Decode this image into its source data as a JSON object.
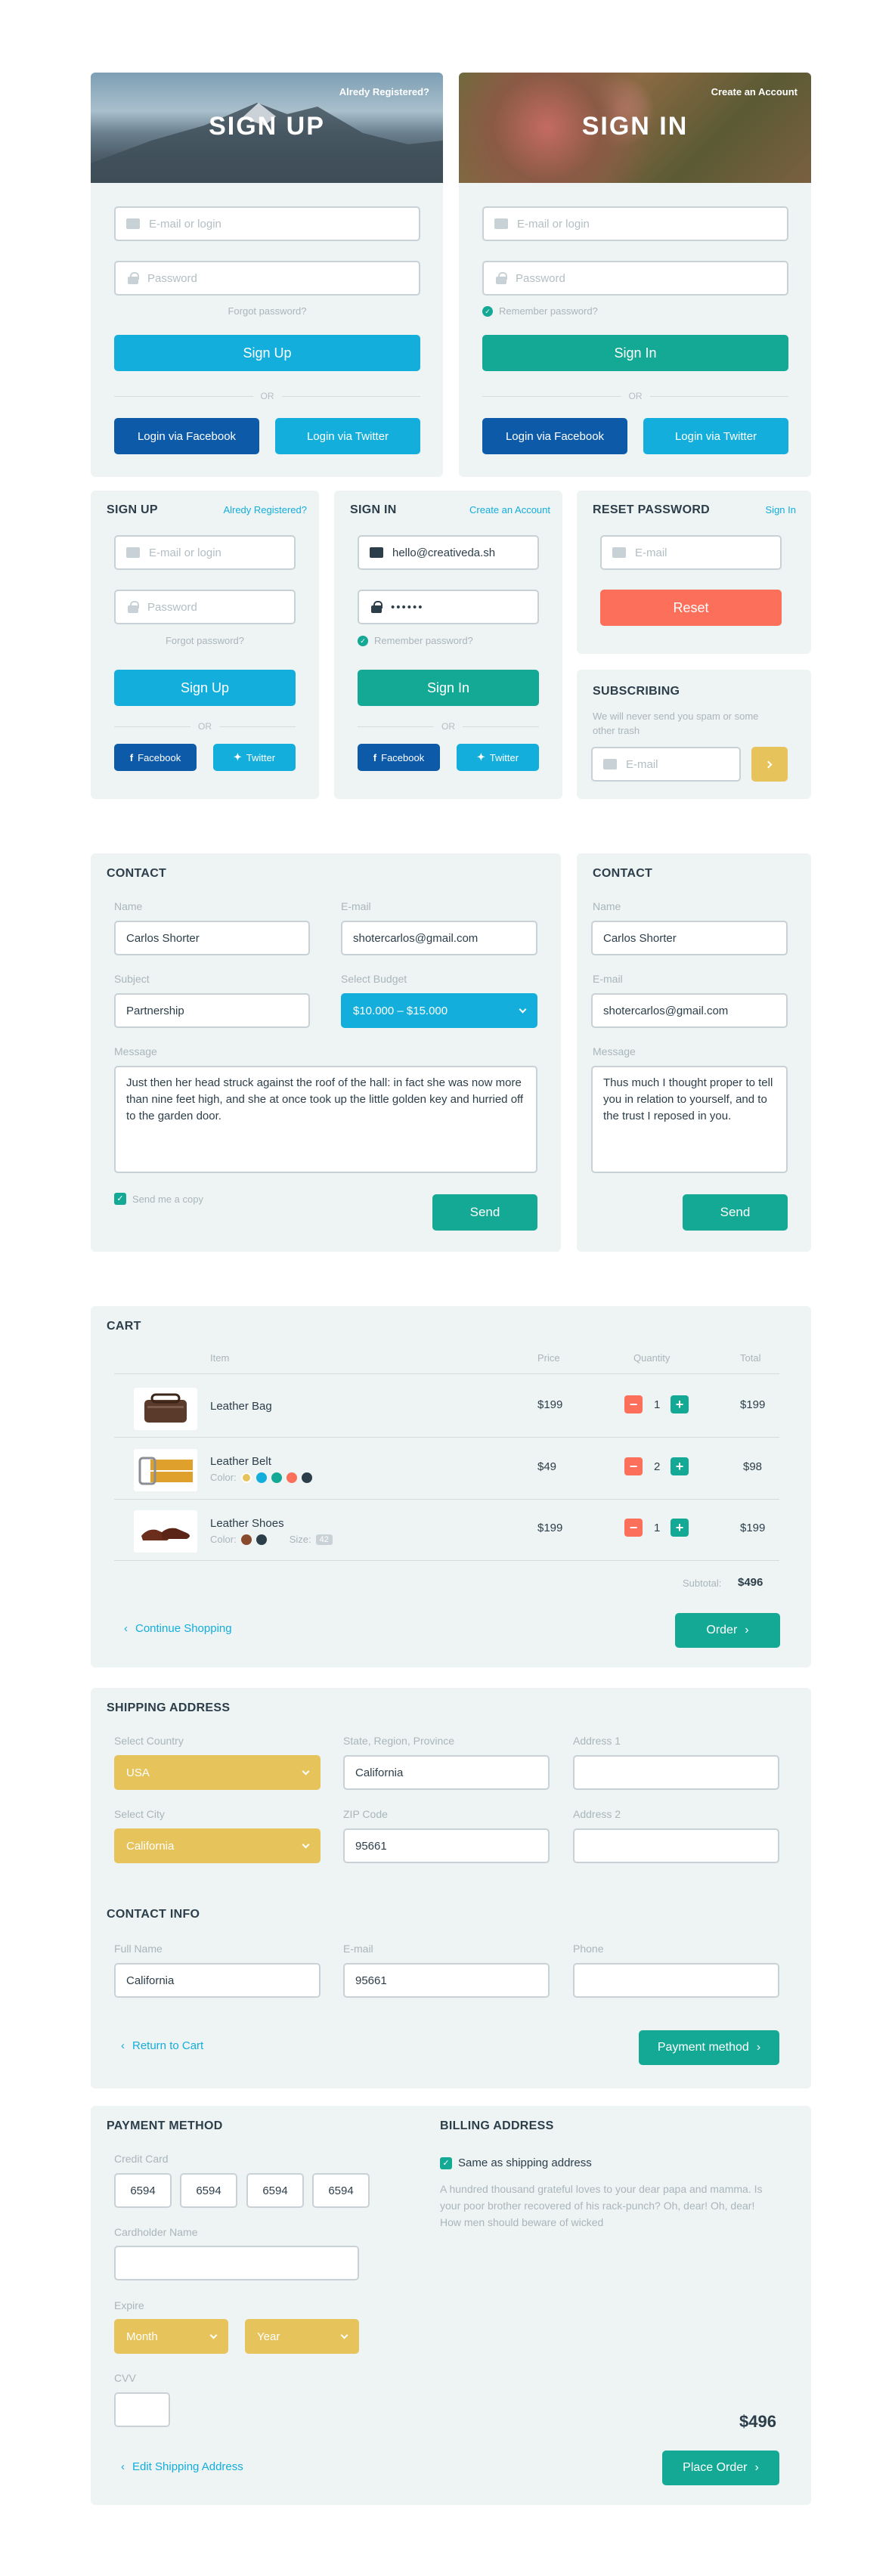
{
  "colors": {
    "blue": "#13aedb",
    "teal": "#14a994",
    "navy": "#0c5aa8",
    "coral": "#fb6f5b",
    "yellow": "#e6c45b",
    "panel": "#eef3f4"
  },
  "signup_large": {
    "title": "SIGN UP",
    "corner_link": "Alredy Registered?",
    "email_placeholder": "E-mail or login",
    "password_placeholder": "Password",
    "forgot": "Forgot password?",
    "button": "Sign Up",
    "or": "OR",
    "facebook": "Login via Facebook",
    "twitter": "Login via Twitter"
  },
  "signin_large": {
    "title": "SIGN IN",
    "corner_link": "Create an Account",
    "email_placeholder": "E-mail or login",
    "password_placeholder": "Password",
    "remember": "Remember password?",
    "button": "Sign In",
    "or": "OR",
    "facebook": "Login via Facebook",
    "twitter": "Login via Twitter"
  },
  "signup_small": {
    "title": "SIGN UP",
    "corner_link": "Alredy Registered?",
    "email_placeholder": "E-mail or login",
    "password_placeholder": "Password",
    "forgot": "Forgot password?",
    "button": "Sign Up",
    "or": "OR",
    "facebook": "Facebook",
    "twitter": "Twitter"
  },
  "signin_small": {
    "title": "SIGN IN",
    "corner_link": "Create an Account",
    "email_value": "hello@creativeda.sh",
    "password_value": "••••••",
    "remember": "Remember password?",
    "button": "Sign In",
    "or": "OR",
    "facebook": "Facebook",
    "twitter": "Twitter"
  },
  "reset": {
    "title": "RESET PASSWORD",
    "corner_link": "Sign In",
    "email_placeholder": "E-mail",
    "button": "Reset"
  },
  "subscribing": {
    "title": "SUBSCRIBING",
    "text": "We will never send you spam or some other trash",
    "email_placeholder": "E-mail"
  },
  "contact_large": {
    "title": "CONTACT",
    "name_label": "Name",
    "name_value": "Carlos Shorter",
    "email_label": "E-mail",
    "email_value": "shotercarlos@gmail.com",
    "subject_label": "Subject",
    "subject_value": "Partnership",
    "budget_label": "Select Budget",
    "budget_value": "$10.000 – $15.000",
    "message_label": "Message",
    "message_value": "Just then her head struck against the roof of the hall: in fact she was now more than nine feet high, and she at once took up the little golden key and hurried off to the garden door.",
    "copy": "Send me a copy",
    "button": "Send"
  },
  "contact_small": {
    "title": "CONTACT",
    "name_label": "Name",
    "name_value": "Carlos Shorter",
    "email_label": "E-mail",
    "email_value": "shotercarlos@gmail.com",
    "message_label": "Message",
    "message_value": "Thus much I thought proper to tell you in relation to yourself, and to the trust I reposed in you.",
    "button": "Send"
  },
  "cart": {
    "title": "CART",
    "headers": {
      "item": "Item",
      "price": "Price",
      "quantity": "Quantity",
      "total": "Total"
    },
    "items": [
      {
        "name": "Leather Bag",
        "price": "$199",
        "qty": "1",
        "total": "$199"
      },
      {
        "name": "Leather Belt",
        "color_label": "Color:",
        "price": "$49",
        "qty": "2",
        "total": "$98"
      },
      {
        "name": "Leather Shoes",
        "color_label": "Color:",
        "size_label": "Size:",
        "size_value": "42",
        "price": "$199",
        "qty": "1",
        "total": "$199"
      }
    ],
    "subtotal_label": "Subtotal:",
    "subtotal_value": "$496",
    "continue": "Continue Shopping",
    "order": "Order"
  },
  "shipping": {
    "title": "SHIPPING ADDRESS",
    "country_label": "Select Country",
    "country_value": "USA",
    "state_label": "State, Region, Province",
    "state_value": "California",
    "address1_label": "Address 1",
    "city_label": "Select City",
    "city_value": "California",
    "zip_label": "ZIP Code",
    "zip_value": "95661",
    "address2_label": "Address 2",
    "contact_title": "CONTACT INFO",
    "fullname_label": "Full Name",
    "fullname_value": "California",
    "email_label": "E-mail",
    "email_value": "95661",
    "phone_label": "Phone",
    "back": "Return to Cart",
    "next": "Payment method"
  },
  "payment": {
    "title": "PAYMENT METHOD",
    "card_label": "Credit Card",
    "card_groups": [
      "6594",
      "6594",
      "6594",
      "6594"
    ],
    "holder_label": "Cardholder Name",
    "expire_label": "Expire",
    "month": "Month",
    "year": "Year",
    "cvv_label": "CVV",
    "total": "$496",
    "back": "Edit Shipping Address",
    "place": "Place Order"
  },
  "billing": {
    "title": "BILLING ADDRESS",
    "same": "Same as shipping address",
    "text": "A hundred thousand grateful loves to your dear papa and mamma. Is your poor brother recovered of his rack-punch? Oh, dear! Oh, dear! How men should beware of wicked"
  }
}
